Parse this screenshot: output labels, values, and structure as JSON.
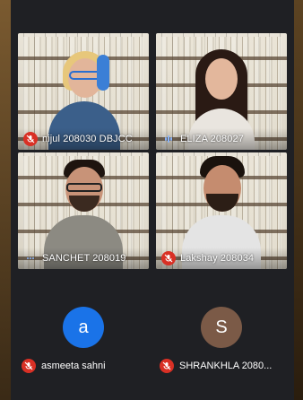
{
  "participants": [
    {
      "name": "nijul 208030 DBJCC",
      "mic": "muted"
    },
    {
      "name": "ELIZA 208027",
      "mic": "speaking"
    },
    {
      "name": "SANCHET 208019",
      "mic": "speaking"
    },
    {
      "name": "Lakshay 208034",
      "mic": "muted"
    }
  ],
  "audio_only": [
    {
      "initial": "a",
      "name": "asmeeta sahni",
      "mic": "muted",
      "color": "#1a73e8"
    },
    {
      "initial": "S",
      "name": "SHRANKHLA 2080...",
      "mic": "muted",
      "color": "#7b5a47"
    }
  ],
  "colors": {
    "muted_mic": "#d93025",
    "background": "#1f2024"
  }
}
